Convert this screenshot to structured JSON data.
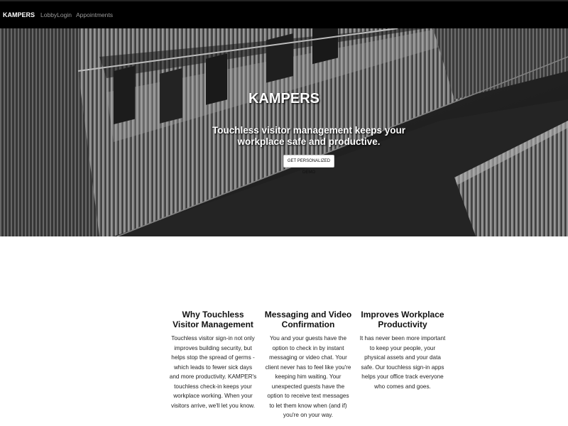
{
  "navbar": {
    "brand": "KAMPERS",
    "links": [
      "LobbyLogin",
      "Appointments"
    ]
  },
  "hero": {
    "title": "KAMPERS",
    "subtitle": "Touchless visitor management keeps your workplace safe and productive.",
    "cta_label": "GET PERSONALIZED DEMO"
  },
  "features": [
    {
      "title": "Why Touchless Visitor Management",
      "body": "Touchless visitor sign-in not only improves building security, but helps stop the spread of germs - which leads to fewer sick days and more productivity. KAMPER's touchless check-in keeps your workplace working. When your visitors arrive, we'll let you know."
    },
    {
      "title": "Messaging and Video Confirmation",
      "body": "You and your guests have the option to check in by instant messaging or video chat. Your client never has to feel like you're keeping him waiting. Your unexpected guests have the option to receive text messages to let them know when (and if) you're on your way."
    },
    {
      "title": "Improves Workplace Productivity",
      "body": "It has never been more important to keep your people, your physical assets and your data safe. Our touchless sign-in apps helps your office track everyone who comes and goes."
    }
  ]
}
